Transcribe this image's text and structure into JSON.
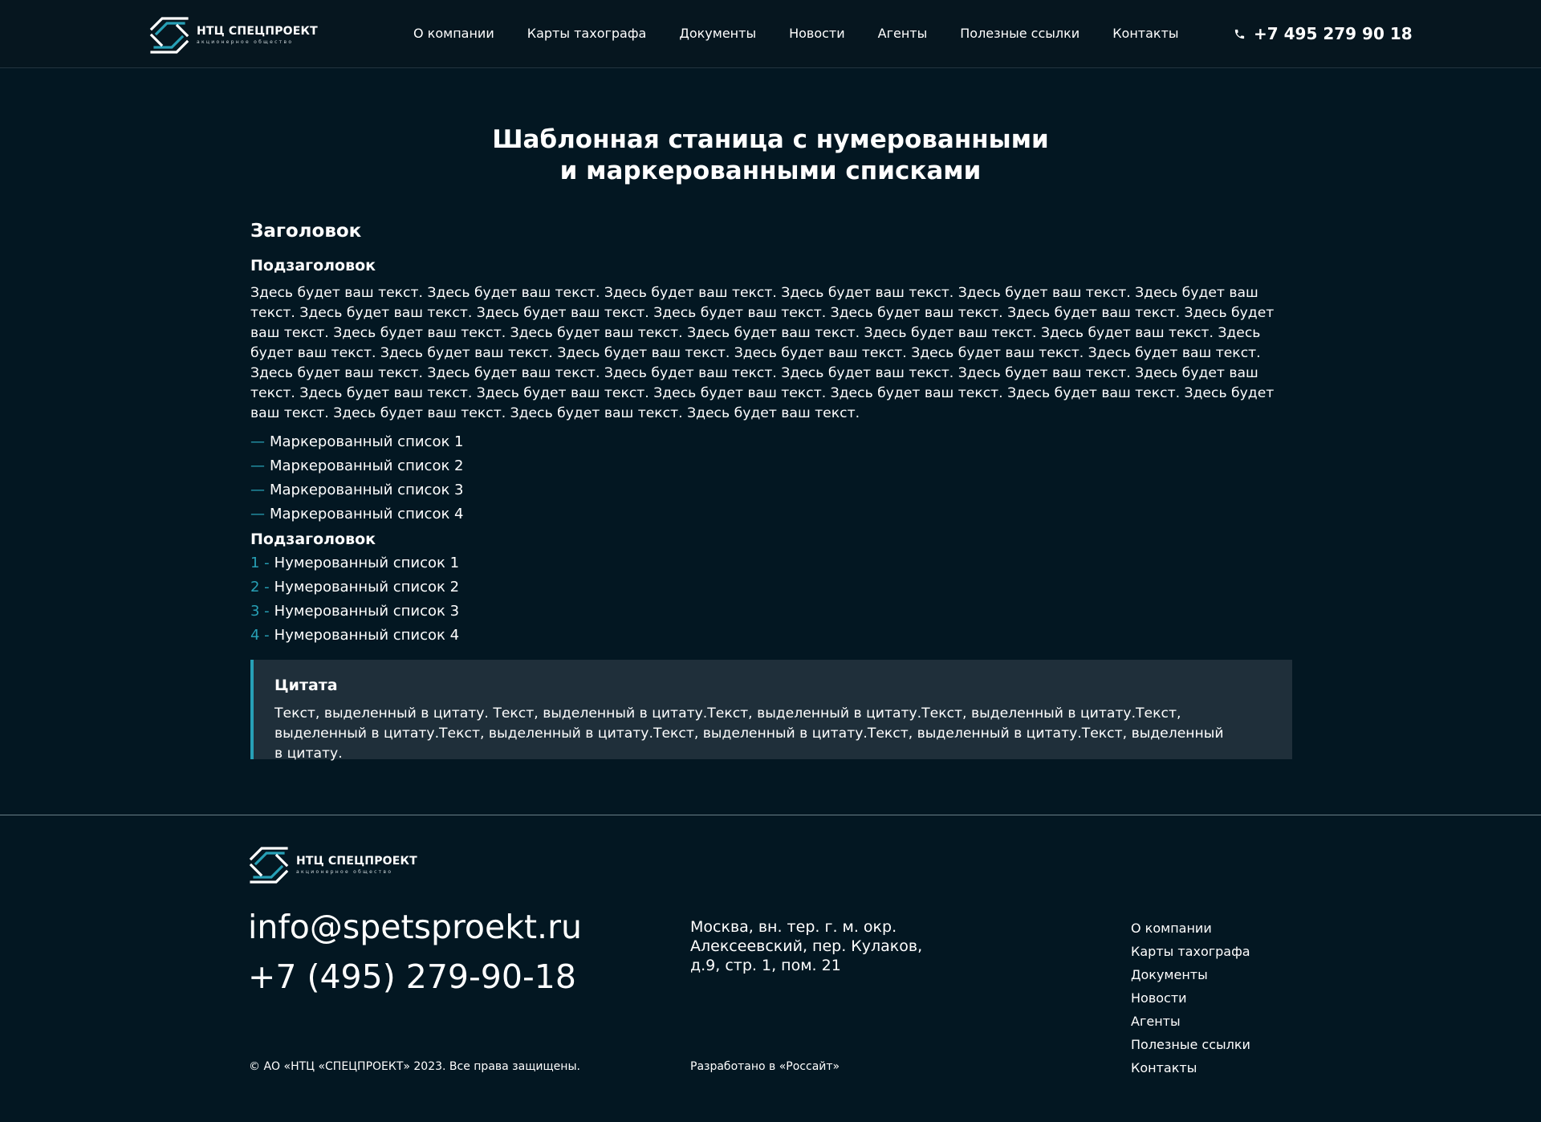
{
  "colors": {
    "background": "#031722",
    "header_background": "#06161f",
    "accent": "#27a0b6",
    "quote_background": "#1f2f3a",
    "text": "#ffffff"
  },
  "header": {
    "logo": {
      "name": "НТЦ СПЕЦПРОЕКТ",
      "subtitle": "акционерное общество",
      "icon": "spetsproekt-logo-icon"
    },
    "nav": [
      "О компании",
      "Карты тахографа",
      "Документы",
      "Новости",
      "Агенты",
      "Полезные ссылки",
      "Контакты"
    ],
    "phone_icon": "phone-icon",
    "phone": "+7 495 279 90 18"
  },
  "main": {
    "title_line1": "Шаблонная станица с нумерованными",
    "title_line2": "и маркерованными списками",
    "heading": "Заголовок",
    "subheading1": "Подзаголовок",
    "paragraph": "Здесь будет ваш текст. Здесь будет ваш текст. Здесь будет ваш текст. Здесь будет ваш текст. Здесь будет ваш текст. Здесь будет ваш текст. Здесь будет ваш текст. Здесь будет ваш текст. Здесь будет ваш текст. Здесь будет ваш текст. Здесь будет ваш текст. Здесь будет ваш текст. Здесь будет ваш текст. Здесь будет ваш текст. Здесь будет ваш текст. Здесь будет ваш текст. Здесь будет ваш текст. Здесь будет ваш текст. Здесь будет ваш текст. Здесь будет ваш текст. Здесь будет ваш текст. Здесь будет ваш текст. Здесь будет ваш текст. Здесь будет ваш текст. Здесь будет ваш текст. Здесь будет ваш текст. Здесь будет ваш текст. Здесь будет ваш текст. Здесь будет ваш текст. Здесь будет ваш текст. Здесь будет ваш текст. Здесь будет ваш текст. Здесь будет ваш текст. Здесь будет ваш текст. Здесь будет ваш текст. Здесь будет ваш текст. Здесь будет ваш текст. Здесь будет ваш текст.",
    "bullet_marker": "—",
    "bullet_items": [
      "Маркерованный список 1",
      "Маркерованный список 2",
      "Маркерованный список 3",
      "Маркерованный список 4"
    ],
    "subheading2": "Подзаголовок",
    "numbered_items": [
      {
        "marker": "1 -",
        "text": "Нумерованный список 1"
      },
      {
        "marker": "2 -",
        "text": "Нумерованный список 2"
      },
      {
        "marker": "3 -",
        "text": "Нумерованный список 3"
      },
      {
        "marker": "4 -",
        "text": "Нумерованный список 4"
      }
    ],
    "quote": {
      "title": "Цитата",
      "text": "Текст, выделенный в цитату. Текст, выделенный в цитату.Текст, выделенный в цитату.Текст, выделенный в цитату.Текст, выделенный в цитату.Текст, выделенный в цитату.Текст, выделенный в цитату.Текст, выделенный в цитату.Текст, выделенный в цитату."
    }
  },
  "footer": {
    "logo": {
      "name": "НТЦ СПЕЦПРОЕКТ",
      "subtitle": "акционерное общество"
    },
    "email": "info@spetsproekt.ru",
    "phone": "+7 (495) 279-90-18",
    "address_lines": [
      "Москва, вн. тер. г. м. окр.",
      "Алексеевский, пер. Кулаков,",
      "д.9, стр. 1, пом. 21"
    ],
    "nav": [
      "О компании",
      "Карты тахографа",
      "Документы",
      "Новости",
      "Агенты",
      "Полезные ссылки",
      "Контакты"
    ],
    "copyright": "© АО «НТЦ «СПЕЦПРОЕКТ» 2023. Все права защищены.",
    "developed": "Разработано в «Россайт»"
  }
}
